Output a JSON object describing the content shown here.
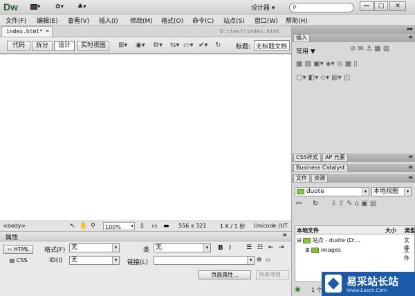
{
  "app": {
    "logo": "Dw",
    "workspace": "设计器 ▾",
    "search_placeholder": "ρ"
  },
  "window_buttons": [
    "—",
    "□",
    "✕"
  ],
  "menu": [
    "文件(F)",
    "编辑(E)",
    "查看(V)",
    "插入(I)",
    "修改(M)",
    "格式(O)",
    "命令(C)",
    "站点(S)",
    "窗口(W)",
    "帮助(H)"
  ],
  "document": {
    "tab": "index.html*",
    "close": "×",
    "path": "D:\\test\\index.html"
  },
  "view_buttons": [
    "代码",
    "拆分",
    "设计",
    "实时视图"
  ],
  "title_label": "标题:",
  "title_value": "无标题文档",
  "status": {
    "tag": "<body>",
    "zoom": "100%",
    "size": "556 x 321",
    "filesize": "1 K / 1 秒",
    "encoding": "Unicode (UT"
  },
  "properties": {
    "title": "属性",
    "html_btn": "HTML",
    "css_btn": "CSS",
    "format_label": "格式(F)",
    "format_value": "无",
    "class_label": "类",
    "class_value": "无",
    "id_label": "ID(I)",
    "id_value": "无",
    "link_label": "链接(L)",
    "bold": "B",
    "italic": "I",
    "page_props": "页面属性...",
    "list_item": "列表项目..."
  },
  "insert_panel": {
    "tab": "插入",
    "category": "常用"
  },
  "css_tabs": [
    "CSS样式",
    "AP 元素"
  ],
  "bc_tab": "Business Catalyst",
  "files_tabs": [
    "文件",
    "资源"
  ],
  "files": {
    "site": "duote",
    "view": "本地视图",
    "col_local": "本地文件",
    "col_size": "大小",
    "col_type": "类型",
    "rows": [
      {
        "name": "站点 - duote (D:...",
        "type": "文件"
      },
      {
        "name": "images",
        "type": "文件"
      }
    ],
    "bottom_text": "1 个"
  },
  "watermark": {
    "title": "易采站长站",
    "sub": "Www.Easck.Com"
  }
}
